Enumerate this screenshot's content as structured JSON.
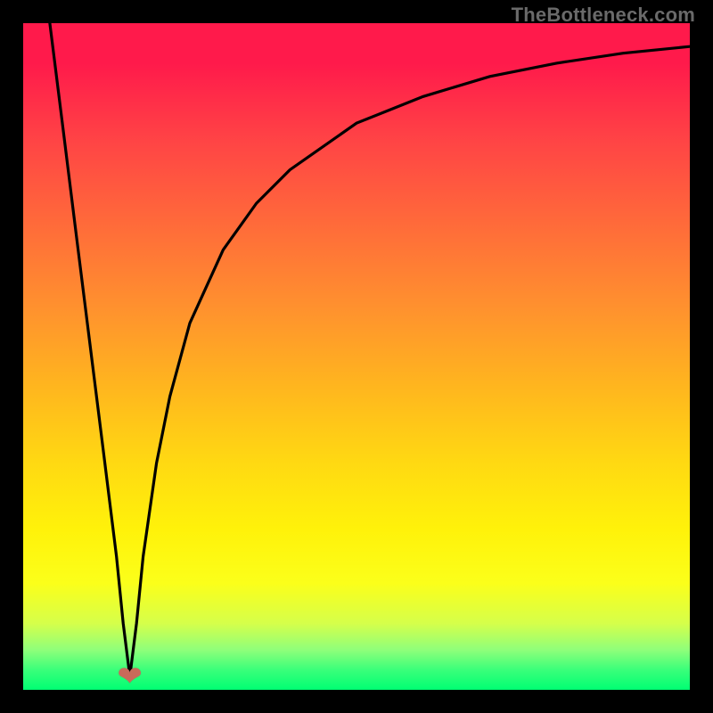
{
  "watermark": {
    "text": "TheBottleneck.com"
  },
  "heart_glyph": "❤",
  "chart_data": {
    "type": "line",
    "title": "",
    "xlabel": "",
    "ylabel": "",
    "xlim": [
      0,
      100
    ],
    "ylim": [
      0,
      100
    ],
    "grid": false,
    "legend": false,
    "annotations": [
      {
        "name": "heart-marker",
        "x": 16,
        "y": 2
      }
    ],
    "series": [
      {
        "name": "left-branch",
        "x": [
          4,
          6,
          8,
          10,
          12,
          14,
          15,
          16
        ],
        "y": [
          100,
          84,
          68,
          52,
          36,
          20,
          10,
          2
        ]
      },
      {
        "name": "right-branch",
        "x": [
          16,
          17,
          18,
          20,
          22,
          25,
          30,
          35,
          40,
          50,
          60,
          70,
          80,
          90,
          100
        ],
        "y": [
          2,
          10,
          20,
          34,
          44,
          55,
          66,
          73,
          78,
          85,
          89,
          92,
          94,
          95.5,
          96.5
        ]
      }
    ],
    "background": {
      "type": "vertical-gradient",
      "stops": [
        {
          "pos": 0.0,
          "color": "#ff1a4b"
        },
        {
          "pos": 0.5,
          "color": "#ffb41f"
        },
        {
          "pos": 0.8,
          "color": "#fff20a"
        },
        {
          "pos": 0.95,
          "color": "#8fff7a"
        },
        {
          "pos": 1.0,
          "color": "#00ff73"
        }
      ]
    }
  }
}
